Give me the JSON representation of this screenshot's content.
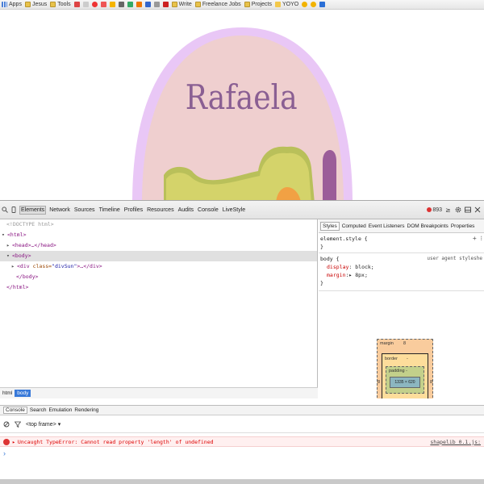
{
  "bookmarks": [
    "Apps",
    "Jesus",
    "Tools",
    "Write",
    "Freelance Jobs",
    "Projects",
    "YOYO"
  ],
  "page": {
    "heading": "Rafaela",
    "colors": {
      "outer_arc": "#e9c7f6",
      "inner": "#efcfcf",
      "text": "#8a5f93",
      "hill": "#d4d36a",
      "hill_shadow": "#b9c05a",
      "tree": "#9b5d99",
      "sun": "#f1a144"
    }
  },
  "devtools": {
    "tabs": [
      "Elements",
      "Network",
      "Sources",
      "Timeline",
      "Profiles",
      "Resources",
      "Audits",
      "Console",
      "LiveStyle"
    ],
    "error_count": "893",
    "dom": {
      "doctype": "<!DOCTYPE html>",
      "html_open": "<html>",
      "head": "<head>…</head>",
      "body_open": "<body>",
      "div_tag": "<div",
      "div_attr": "class=",
      "div_val": "\"divSun\"",
      "div_end": ">…</div>",
      "body_close": "</body>",
      "html_close": "</html>"
    },
    "breadcrumbs": [
      "html",
      "body"
    ],
    "styles_tabs": [
      "Styles",
      "Computed",
      "Event Listeners",
      "DOM Breakpoints",
      "Properties"
    ],
    "element_style": "element.style {",
    "rule_close": "}",
    "body_rule": {
      "selector": "body {",
      "source": "user agent styleshe",
      "props": [
        {
          "name": "display",
          "value": " block;"
        },
        {
          "name": "margin",
          "value": "▸ 8px;"
        }
      ]
    },
    "box_model": {
      "margin_label": "margin",
      "margin_value": "8",
      "border_label": "border",
      "border_value": "-",
      "padding_label": "padding -",
      "content": "1335 × 620",
      "side_left": "8",
      "side_right": "8"
    },
    "console_tabs": [
      "Console",
      "Search",
      "Emulation",
      "Rendering"
    ],
    "frame": "<top frame>",
    "error_message": "Uncaught TypeError: Cannot read property 'length' of undefined",
    "error_source": "shapelib 0.1.js:",
    "prompt": "›"
  }
}
